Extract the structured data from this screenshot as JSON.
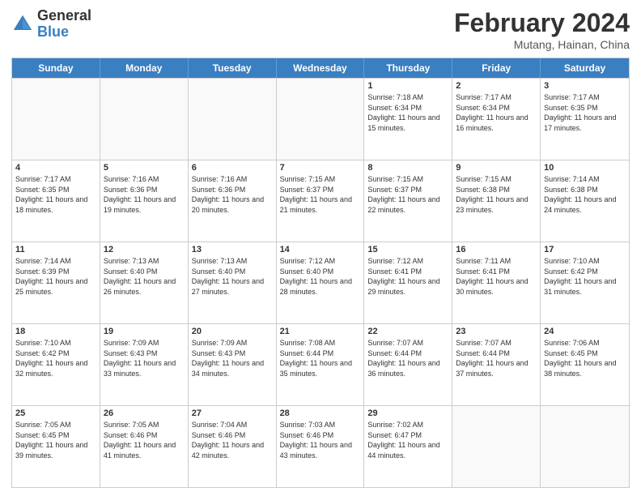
{
  "header": {
    "logo_general": "General",
    "logo_blue": "Blue",
    "month_title": "February 2024",
    "location": "Mutang, Hainan, China"
  },
  "days_of_week": [
    "Sunday",
    "Monday",
    "Tuesday",
    "Wednesday",
    "Thursday",
    "Friday",
    "Saturday"
  ],
  "weeks": [
    [
      {
        "day": "",
        "empty": true,
        "info": ""
      },
      {
        "day": "",
        "empty": true,
        "info": ""
      },
      {
        "day": "",
        "empty": true,
        "info": ""
      },
      {
        "day": "",
        "empty": true,
        "info": ""
      },
      {
        "day": "1",
        "empty": false,
        "info": "Sunrise: 7:18 AM\nSunset: 6:34 PM\nDaylight: 11 hours and 15 minutes."
      },
      {
        "day": "2",
        "empty": false,
        "info": "Sunrise: 7:17 AM\nSunset: 6:34 PM\nDaylight: 11 hours and 16 minutes."
      },
      {
        "day": "3",
        "empty": false,
        "info": "Sunrise: 7:17 AM\nSunset: 6:35 PM\nDaylight: 11 hours and 17 minutes."
      }
    ],
    [
      {
        "day": "4",
        "empty": false,
        "info": "Sunrise: 7:17 AM\nSunset: 6:35 PM\nDaylight: 11 hours and 18 minutes."
      },
      {
        "day": "5",
        "empty": false,
        "info": "Sunrise: 7:16 AM\nSunset: 6:36 PM\nDaylight: 11 hours and 19 minutes."
      },
      {
        "day": "6",
        "empty": false,
        "info": "Sunrise: 7:16 AM\nSunset: 6:36 PM\nDaylight: 11 hours and 20 minutes."
      },
      {
        "day": "7",
        "empty": false,
        "info": "Sunrise: 7:15 AM\nSunset: 6:37 PM\nDaylight: 11 hours and 21 minutes."
      },
      {
        "day": "8",
        "empty": false,
        "info": "Sunrise: 7:15 AM\nSunset: 6:37 PM\nDaylight: 11 hours and 22 minutes."
      },
      {
        "day": "9",
        "empty": false,
        "info": "Sunrise: 7:15 AM\nSunset: 6:38 PM\nDaylight: 11 hours and 23 minutes."
      },
      {
        "day": "10",
        "empty": false,
        "info": "Sunrise: 7:14 AM\nSunset: 6:38 PM\nDaylight: 11 hours and 24 minutes."
      }
    ],
    [
      {
        "day": "11",
        "empty": false,
        "info": "Sunrise: 7:14 AM\nSunset: 6:39 PM\nDaylight: 11 hours and 25 minutes."
      },
      {
        "day": "12",
        "empty": false,
        "info": "Sunrise: 7:13 AM\nSunset: 6:40 PM\nDaylight: 11 hours and 26 minutes."
      },
      {
        "day": "13",
        "empty": false,
        "info": "Sunrise: 7:13 AM\nSunset: 6:40 PM\nDaylight: 11 hours and 27 minutes."
      },
      {
        "day": "14",
        "empty": false,
        "info": "Sunrise: 7:12 AM\nSunset: 6:40 PM\nDaylight: 11 hours and 28 minutes."
      },
      {
        "day": "15",
        "empty": false,
        "info": "Sunrise: 7:12 AM\nSunset: 6:41 PM\nDaylight: 11 hours and 29 minutes."
      },
      {
        "day": "16",
        "empty": false,
        "info": "Sunrise: 7:11 AM\nSunset: 6:41 PM\nDaylight: 11 hours and 30 minutes."
      },
      {
        "day": "17",
        "empty": false,
        "info": "Sunrise: 7:10 AM\nSunset: 6:42 PM\nDaylight: 11 hours and 31 minutes."
      }
    ],
    [
      {
        "day": "18",
        "empty": false,
        "info": "Sunrise: 7:10 AM\nSunset: 6:42 PM\nDaylight: 11 hours and 32 minutes."
      },
      {
        "day": "19",
        "empty": false,
        "info": "Sunrise: 7:09 AM\nSunset: 6:43 PM\nDaylight: 11 hours and 33 minutes."
      },
      {
        "day": "20",
        "empty": false,
        "info": "Sunrise: 7:09 AM\nSunset: 6:43 PM\nDaylight: 11 hours and 34 minutes."
      },
      {
        "day": "21",
        "empty": false,
        "info": "Sunrise: 7:08 AM\nSunset: 6:44 PM\nDaylight: 11 hours and 35 minutes."
      },
      {
        "day": "22",
        "empty": false,
        "info": "Sunrise: 7:07 AM\nSunset: 6:44 PM\nDaylight: 11 hours and 36 minutes."
      },
      {
        "day": "23",
        "empty": false,
        "info": "Sunrise: 7:07 AM\nSunset: 6:44 PM\nDaylight: 11 hours and 37 minutes."
      },
      {
        "day": "24",
        "empty": false,
        "info": "Sunrise: 7:06 AM\nSunset: 6:45 PM\nDaylight: 11 hours and 38 minutes."
      }
    ],
    [
      {
        "day": "25",
        "empty": false,
        "info": "Sunrise: 7:05 AM\nSunset: 6:45 PM\nDaylight: 11 hours and 39 minutes."
      },
      {
        "day": "26",
        "empty": false,
        "info": "Sunrise: 7:05 AM\nSunset: 6:46 PM\nDaylight: 11 hours and 41 minutes."
      },
      {
        "day": "27",
        "empty": false,
        "info": "Sunrise: 7:04 AM\nSunset: 6:46 PM\nDaylight: 11 hours and 42 minutes."
      },
      {
        "day": "28",
        "empty": false,
        "info": "Sunrise: 7:03 AM\nSunset: 6:46 PM\nDaylight: 11 hours and 43 minutes."
      },
      {
        "day": "29",
        "empty": false,
        "info": "Sunrise: 7:02 AM\nSunset: 6:47 PM\nDaylight: 11 hours and 44 minutes."
      },
      {
        "day": "",
        "empty": true,
        "info": ""
      },
      {
        "day": "",
        "empty": true,
        "info": ""
      }
    ]
  ]
}
